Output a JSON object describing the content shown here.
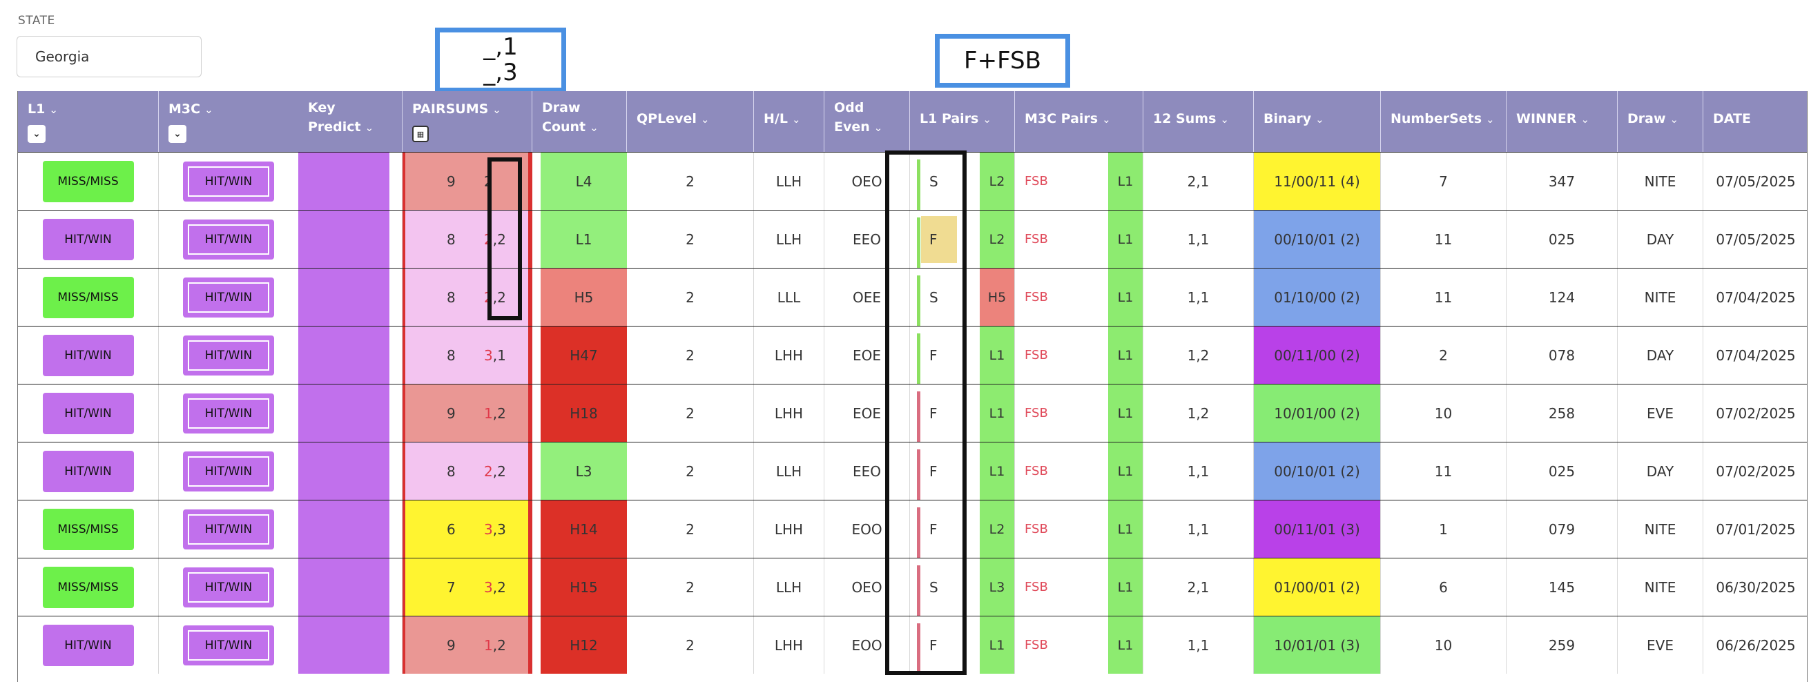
{
  "state": {
    "label": "STATE",
    "value": "Georgia"
  },
  "callouts": {
    "pairsums": [
      "_,1",
      "_,3"
    ],
    "fsb": "F+FSB"
  },
  "columns": [
    {
      "key": "l1",
      "label": "L1"
    },
    {
      "key": "m3c",
      "label": "M3C"
    },
    {
      "key": "key_predict",
      "label": "Key\nPredict"
    },
    {
      "key": "pairsums",
      "label": "PAIRSUMS"
    },
    {
      "key": "draw_count",
      "label": "Draw\nCount"
    },
    {
      "key": "qplevel",
      "label": "QPLevel"
    },
    {
      "key": "hl",
      "label": "H/L"
    },
    {
      "key": "odd_even",
      "label": "Odd\nEven"
    },
    {
      "key": "l1_pairs",
      "label": "L1 Pairs"
    },
    {
      "key": "m3c_pairs",
      "label": "M3C Pairs"
    },
    {
      "key": "sums12",
      "label": "12 Sums"
    },
    {
      "key": "binary",
      "label": "Binary"
    },
    {
      "key": "numbersets",
      "label": "NumberSets"
    },
    {
      "key": "winner",
      "label": "WINNER"
    },
    {
      "key": "draw",
      "label": "Draw"
    },
    {
      "key": "date",
      "label": "DATE"
    }
  ],
  "colors": {
    "header": "#8e8bbd",
    "l1_green": "#6df04a",
    "l1_purple": "#c170ec",
    "key_predict": "#c170ec",
    "ps_salmon": "#ea9794",
    "ps_pink": "#f3c4f0",
    "ps_yellow": "#fff430",
    "dc_green": "#93ef7c",
    "dc_salmon": "#ec837c",
    "dc_red": "#dc3027",
    "pair_green": "#8deb70",
    "pair_salmon": "#ec837c",
    "bin_yellow": "#fff430",
    "bin_blue": "#7ea3e9",
    "bin_purple": "#b941e8",
    "bin_green": "#87eb74",
    "flag_green": "#8ce060",
    "flag_pink": "#d96d80"
  },
  "rows": [
    {
      "l1": "MISS/MISS",
      "l1_color": "green",
      "m3c": "HIT/WIN",
      "ps_a": "9",
      "ps_b_red": "",
      "ps_b": "2",
      "ps_color": "salmon",
      "draw_count": "L4",
      "dc_color": "green",
      "qplevel": "2",
      "hl": "LLH",
      "odd_even": "OEO",
      "l1_pair": "S",
      "l1_flag": "green",
      "l1_highlight": false,
      "l1_code": "L2",
      "l1_code_color": "green",
      "m3c_pair": "FSB",
      "m3c_code": "L1",
      "sums12": "2,1",
      "binary": "11/00/11 (4)",
      "bin_color": "yellow",
      "numbersets": "7",
      "winner": "347",
      "draw": "NITE",
      "date": "07/05/2025"
    },
    {
      "l1": "HIT/WIN",
      "l1_color": "purple",
      "m3c": "HIT/WIN",
      "ps_a": "8",
      "ps_b_red": "2",
      "ps_b": ",2",
      "ps_color": "pink",
      "draw_count": "L1",
      "dc_color": "green",
      "qplevel": "2",
      "hl": "LLH",
      "odd_even": "EEO",
      "l1_pair": "F",
      "l1_flag": "green",
      "l1_highlight": true,
      "l1_code": "L2",
      "l1_code_color": "green",
      "m3c_pair": "FSB",
      "m3c_code": "L1",
      "sums12": "1,1",
      "binary": "00/10/01 (2)",
      "bin_color": "blue",
      "numbersets": "11",
      "winner": "025",
      "draw": "DAY",
      "date": "07/05/2025"
    },
    {
      "l1": "MISS/MISS",
      "l1_color": "green",
      "m3c": "HIT/WIN",
      "ps_a": "8",
      "ps_b_red": "2",
      "ps_b": ",2",
      "ps_color": "pink",
      "draw_count": "H5",
      "dc_color": "salmon",
      "qplevel": "2",
      "hl": "LLL",
      "odd_even": "OEE",
      "l1_pair": "S",
      "l1_flag": "green",
      "l1_highlight": false,
      "l1_code": "H5",
      "l1_code_color": "salmon",
      "m3c_pair": "FSB",
      "m3c_code": "L1",
      "sums12": "1,1",
      "binary": "01/10/00 (2)",
      "bin_color": "blue",
      "numbersets": "11",
      "winner": "124",
      "draw": "NITE",
      "date": "07/04/2025"
    },
    {
      "l1": "HIT/WIN",
      "l1_color": "purple",
      "m3c": "HIT/WIN",
      "ps_a": "8",
      "ps_b_red": "3",
      "ps_b": ",1",
      "ps_color": "pink",
      "draw_count": "H47",
      "dc_color": "red",
      "qplevel": "2",
      "hl": "LHH",
      "odd_even": "EOE",
      "l1_pair": "F",
      "l1_flag": "green",
      "l1_highlight": false,
      "l1_code": "L1",
      "l1_code_color": "green",
      "m3c_pair": "FSB",
      "m3c_code": "L1",
      "sums12": "1,2",
      "binary": "00/11/00 (2)",
      "bin_color": "purple",
      "numbersets": "2",
      "winner": "078",
      "draw": "DAY",
      "date": "07/04/2025"
    },
    {
      "l1": "HIT/WIN",
      "l1_color": "purple",
      "m3c": "HIT/WIN",
      "ps_a": "9",
      "ps_b_red": "1",
      "ps_b": ",2",
      "ps_color": "salmon",
      "draw_count": "H18",
      "dc_color": "red",
      "qplevel": "2",
      "hl": "LHH",
      "odd_even": "EOE",
      "l1_pair": "F",
      "l1_flag": "pink",
      "l1_highlight": false,
      "l1_code": "L1",
      "l1_code_color": "green",
      "m3c_pair": "FSB",
      "m3c_code": "L1",
      "sums12": "1,2",
      "binary": "10/01/00 (2)",
      "bin_color": "green",
      "numbersets": "10",
      "winner": "258",
      "draw": "EVE",
      "date": "07/02/2025"
    },
    {
      "l1": "HIT/WIN",
      "l1_color": "purple",
      "m3c": "HIT/WIN",
      "ps_a": "8",
      "ps_b_red": "2",
      "ps_b": ",2",
      "ps_color": "pink",
      "draw_count": "L3",
      "dc_color": "green",
      "qplevel": "2",
      "hl": "LLH",
      "odd_even": "EEO",
      "l1_pair": "F",
      "l1_flag": "pink",
      "l1_highlight": false,
      "l1_code": "L1",
      "l1_code_color": "green",
      "m3c_pair": "FSB",
      "m3c_code": "L1",
      "sums12": "1,1",
      "binary": "00/10/01 (2)",
      "bin_color": "blue",
      "numbersets": "11",
      "winner": "025",
      "draw": "DAY",
      "date": "07/02/2025"
    },
    {
      "l1": "MISS/MISS",
      "l1_color": "green",
      "m3c": "HIT/WIN",
      "ps_a": "6",
      "ps_b_red": "3",
      "ps_b": ",3",
      "ps_color": "yellow",
      "draw_count": "H14",
      "dc_color": "red",
      "qplevel": "2",
      "hl": "LHH",
      "odd_even": "EOO",
      "l1_pair": "F",
      "l1_flag": "pink",
      "l1_highlight": false,
      "l1_code": "L2",
      "l1_code_color": "green",
      "m3c_pair": "FSB",
      "m3c_code": "L1",
      "sums12": "1,1",
      "binary": "00/11/01 (3)",
      "bin_color": "purple",
      "numbersets": "1",
      "winner": "079",
      "draw": "NITE",
      "date": "07/01/2025"
    },
    {
      "l1": "MISS/MISS",
      "l1_color": "green",
      "m3c": "HIT/WIN",
      "ps_a": "7",
      "ps_b_red": "3",
      "ps_b": ",2",
      "ps_color": "yellow",
      "draw_count": "H15",
      "dc_color": "red",
      "qplevel": "2",
      "hl": "LLH",
      "odd_even": "OEO",
      "l1_pair": "S",
      "l1_flag": "pink",
      "l1_highlight": false,
      "l1_code": "L3",
      "l1_code_color": "green",
      "m3c_pair": "FSB",
      "m3c_code": "L1",
      "sums12": "2,1",
      "binary": "01/00/01 (2)",
      "bin_color": "yellow",
      "numbersets": "6",
      "winner": "145",
      "draw": "NITE",
      "date": "06/30/2025"
    },
    {
      "l1": "HIT/WIN",
      "l1_color": "purple",
      "m3c": "HIT/WIN",
      "ps_a": "9",
      "ps_b_red": "1",
      "ps_b": ",2",
      "ps_color": "salmon",
      "draw_count": "H12",
      "dc_color": "red",
      "qplevel": "2",
      "hl": "LHH",
      "odd_even": "EOO",
      "l1_pair": "F",
      "l1_flag": "pink",
      "l1_highlight": false,
      "l1_code": "L1",
      "l1_code_color": "green",
      "m3c_pair": "FSB",
      "m3c_code": "L1",
      "sums12": "1,1",
      "binary": "10/01/01 (3)",
      "bin_color": "green",
      "numbersets": "10",
      "winner": "259",
      "draw": "EVE",
      "date": "06/26/2025"
    }
  ]
}
